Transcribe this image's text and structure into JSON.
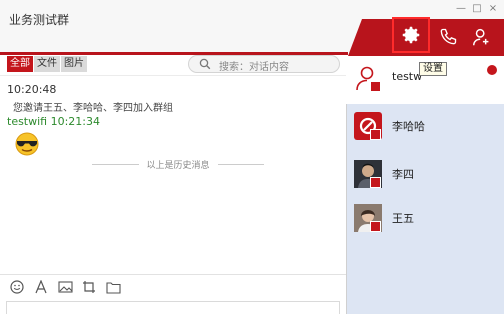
{
  "window": {
    "title": "业务测试群",
    "controls": [
      "—",
      "□",
      "×"
    ]
  },
  "header": {
    "icons": [
      "settings-icon",
      "phone-icon",
      "add-member-icon"
    ],
    "accent_color": "#b8141c",
    "highlight_color": "#ff2b2b"
  },
  "chat": {
    "filters": [
      "全部",
      "文件",
      "图片"
    ],
    "active_filter": "全部",
    "search_placeholder": "搜索：对话内容",
    "messages": {
      "time1": "10:20:48",
      "system_text": "您邀请王五、李哈哈、李四加入群组",
      "sender_line": "testwifi 10:21:34",
      "emoji": "cool-sunglasses-emoji"
    },
    "history_label": "以上是历史消息"
  },
  "toolbar": {
    "icons": [
      "emoji-icon",
      "font-icon",
      "image-icon",
      "screenshot-icon",
      "folder-icon"
    ]
  },
  "members": [
    {
      "name": "testw",
      "avatar": "default-user-avatar"
    },
    {
      "name": "李哈哈",
      "avatar": "red-app-avatar"
    },
    {
      "name": "李四",
      "avatar": "photo-avatar"
    },
    {
      "name": "王五",
      "avatar": "photo-avatar"
    }
  ],
  "tooltip": "设置"
}
